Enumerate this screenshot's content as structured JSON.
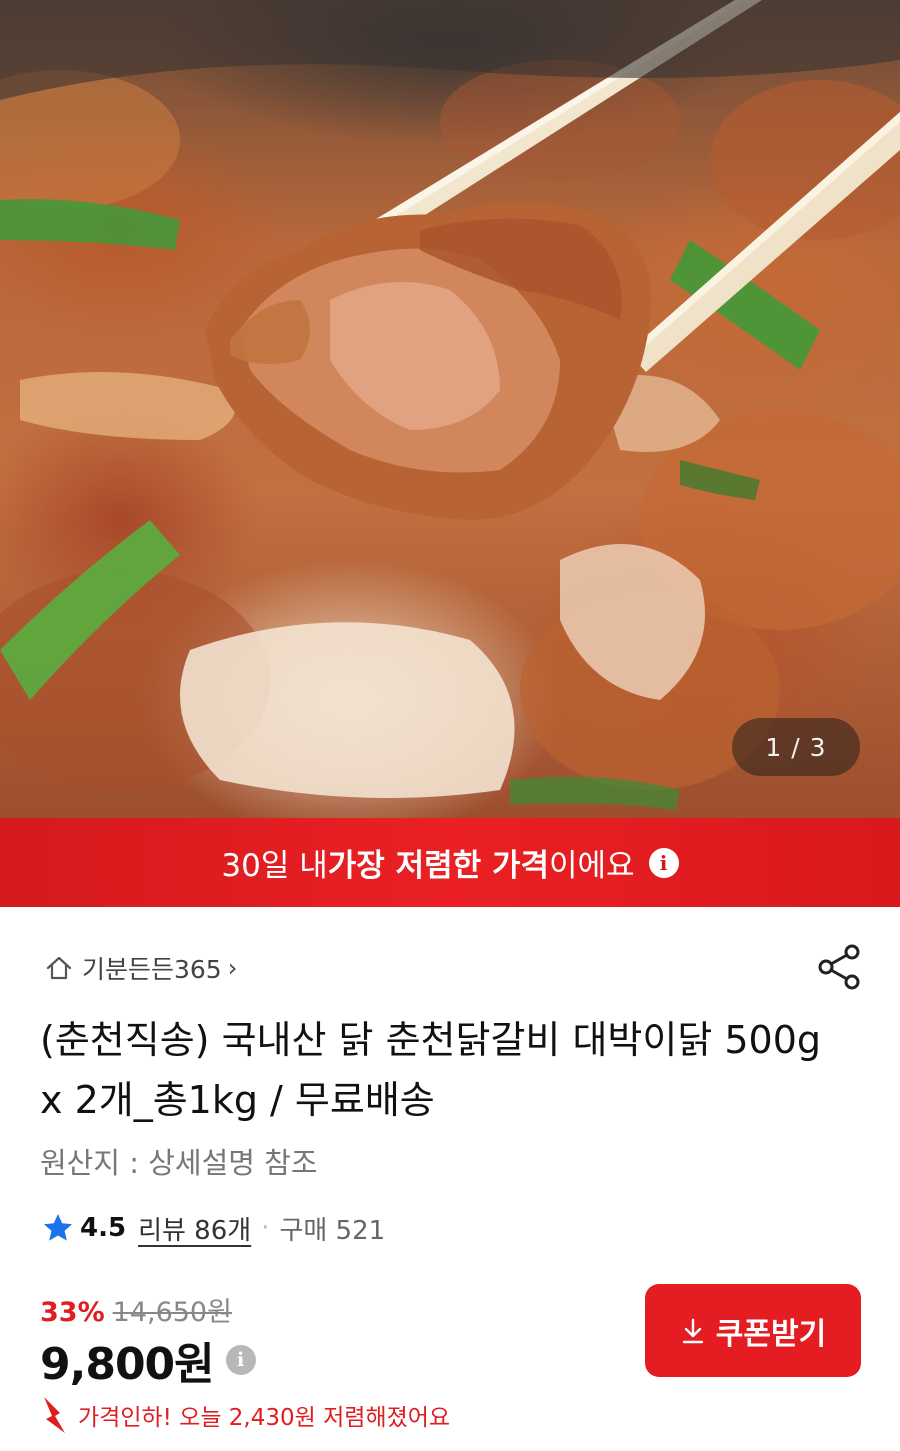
{
  "gallery": {
    "current_page": 1,
    "total_pages": 3,
    "pager_text": "1 / 3"
  },
  "banner": {
    "prefix": "30일 내 ",
    "highlight": "가장 저렴한 가격",
    "suffix": "이에요",
    "icon": "info-icon"
  },
  "store": {
    "name": "기분든든365",
    "icon": "home-icon"
  },
  "share": {
    "icon": "share-icon"
  },
  "product": {
    "title": "(춘천직송) 국내산 닭 춘천닭갈비 대박이닭 500g x 2개_총1kg / 무료배송",
    "origin": "원산지 : 상세설명 참조"
  },
  "rating": {
    "score": "4.5",
    "review_text": "리뷰 86개",
    "purchase_text": "구매 521",
    "star_color": "#1a73e8"
  },
  "price": {
    "discount_rate": "33%",
    "original_price": "14,650원",
    "sale_price": "9,800원",
    "drop_message": "가격인하! 오늘 2,430원 저렴해졌어요"
  },
  "coupon": {
    "label": "쿠폰받기",
    "icon": "download-icon"
  },
  "colors": {
    "brand_red": "#e41d22",
    "banner_red": "#ea2024"
  }
}
